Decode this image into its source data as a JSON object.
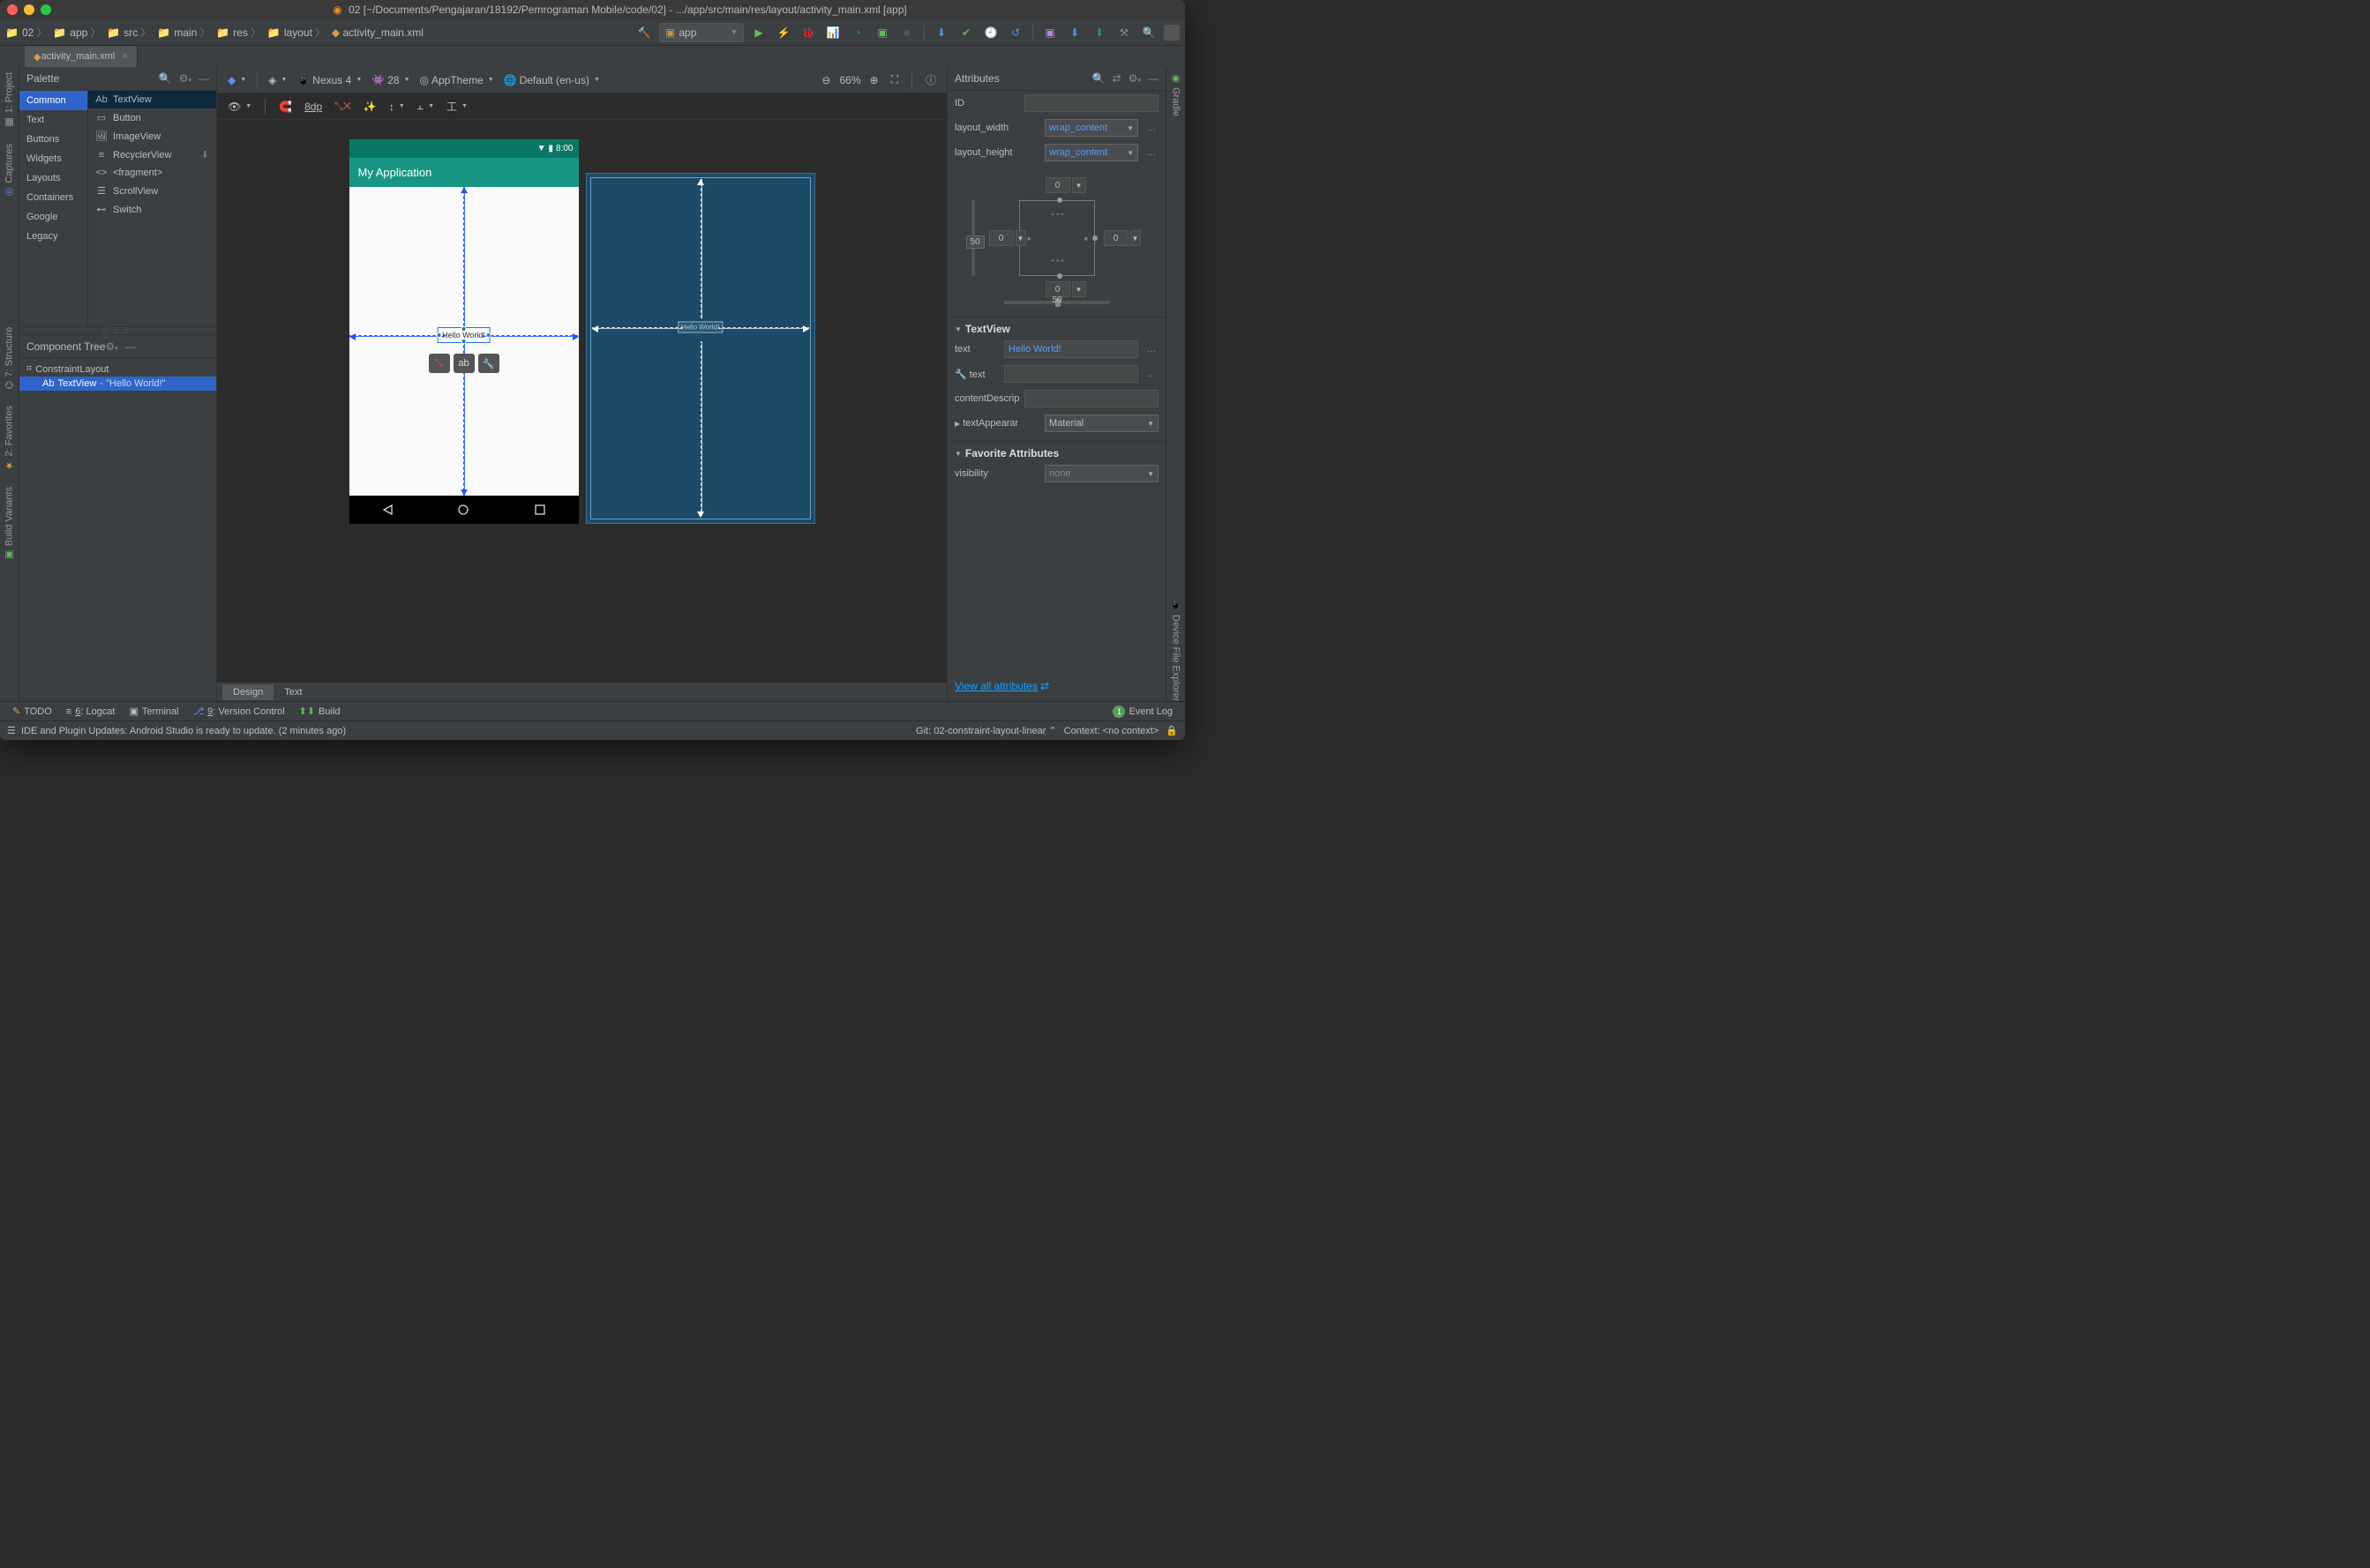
{
  "window_title": "02 [~/Documents/Pengajaran/18192/Pemrograman Mobile/code/02] - .../app/src/main/res/layout/activity_main.xml [app]",
  "breadcrumbs": [
    "02",
    "app",
    "src",
    "main",
    "res",
    "layout",
    "activity_main.xml"
  ],
  "run_config": "app",
  "open_tab": "activity_main.xml",
  "palette": {
    "title": "Palette",
    "categories": [
      "Common",
      "Text",
      "Buttons",
      "Widgets",
      "Layouts",
      "Containers",
      "Google",
      "Legacy"
    ],
    "selected_category": "Common",
    "items": [
      "TextView",
      "Button",
      "ImageView",
      "RecyclerView",
      "<fragment>",
      "ScrollView",
      "Switch"
    ],
    "selected_item": "TextView"
  },
  "component_tree": {
    "title": "Component Tree",
    "root": "ConstraintLayout",
    "child_prefix": "TextView",
    "child_suffix": "- \"Hello World!\""
  },
  "design_toolbar": {
    "device": "Nexus 4",
    "api": "28",
    "theme": "AppTheme",
    "locale": "Default (en-us)",
    "zoom": "66%",
    "dp": "8dp"
  },
  "preview": {
    "status_time": "8:00",
    "app_title": "My Application",
    "hello": "Hello World!"
  },
  "attributes": {
    "title": "Attributes",
    "id_label": "ID",
    "id_value": "",
    "layout_width_label": "layout_width",
    "layout_width_value": "wrap_content",
    "layout_height_label": "layout_height",
    "layout_height_value": "wrap_content",
    "constraint": {
      "top": "0",
      "left": "0",
      "right": "0",
      "bottom": "0",
      "bias_h": "50",
      "bias_v": "50"
    },
    "textview_header": "TextView",
    "text_label": "text",
    "text_value": "Hello World!",
    "text_tool_label": "text",
    "text_tool_value": "",
    "contentDescription_label": "contentDescrip",
    "contentDescription_value": "",
    "textAppearance_label": "textAppearar",
    "textAppearance_value": "Material",
    "fav_header": "Favorite Attributes",
    "visibility_label": "visibility",
    "visibility_value": "none",
    "view_all": "View all attributes"
  },
  "bottom_tabs": {
    "design": "Design",
    "text": "Text"
  },
  "tool_windows": {
    "todo": "TODO",
    "logcat": "6: Logcat",
    "terminal": "Terminal",
    "vcs": "9: Version Control",
    "build": "Build",
    "event_log": "Event Log"
  },
  "status": {
    "message": "IDE and Plugin Updates: Android Studio is ready to update. (2 minutes ago)",
    "git": "Git: 02-constraint-layout-linear",
    "context": "Context: <no context>"
  },
  "left_tool_tabs": [
    "1: Project",
    "Captures",
    "7: Structure",
    "2: Favorites",
    "Build Variants"
  ],
  "right_tool_tabs": [
    "Gradle",
    "Device File Explorer"
  ]
}
